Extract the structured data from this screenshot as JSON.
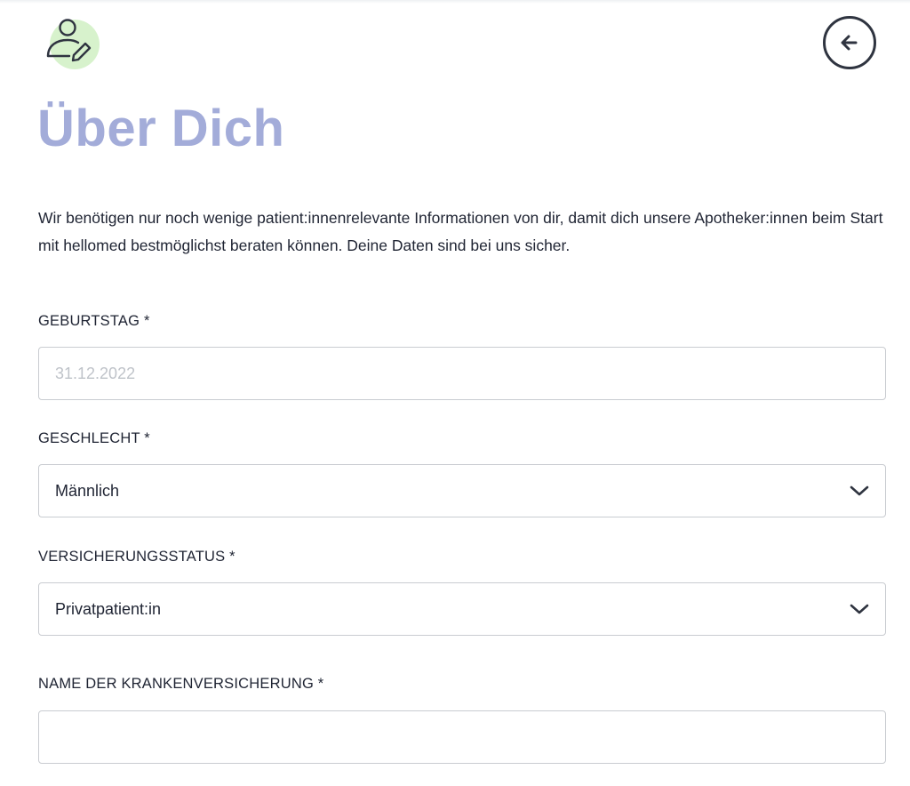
{
  "header": {
    "user_icon": "user-edit-icon",
    "back_icon": "arrow-left-circle-icon"
  },
  "title": "Über Dich",
  "intro": "Wir benötigen nur noch wenige patient:innenrelevante Informationen von dir, damit dich unsere Apotheker:innen beim Start mit hellomed bestmöglichst beraten können. Deine Daten sind bei uns sicher.",
  "form": {
    "birthday": {
      "label": "GEBURTSTAG *",
      "placeholder": "31.12.2022",
      "value": ""
    },
    "gender": {
      "label": "GESCHLECHT *",
      "value": "Männlich"
    },
    "insurance_status": {
      "label": "VERSICHERUNGSSTATUS *",
      "value": "Privatpatient:in"
    },
    "insurance_name": {
      "label": "NAME DER KRANKENVERSICHERUNG *",
      "placeholder": "",
      "value": ""
    }
  },
  "colors": {
    "title": "#a3acd9",
    "icon_bg": "#d7f2cc",
    "text": "#1f2433",
    "border": "#c9ccd1"
  }
}
